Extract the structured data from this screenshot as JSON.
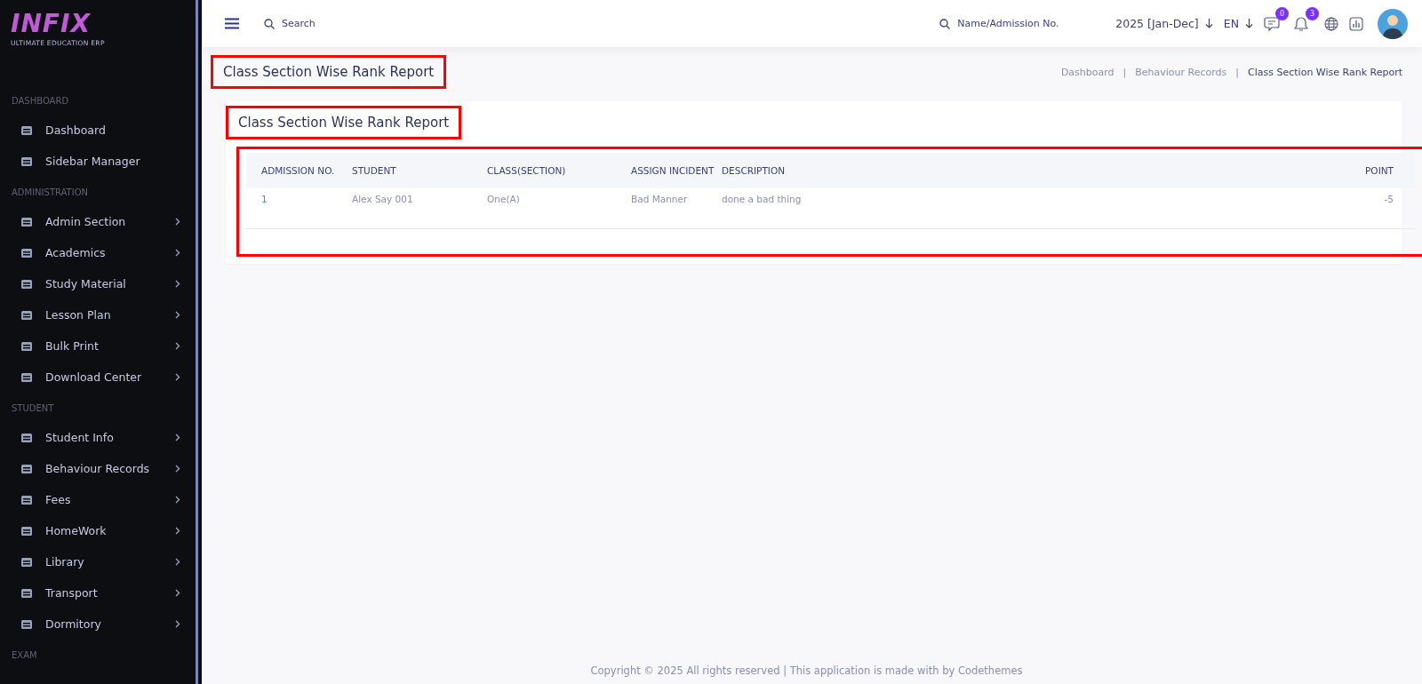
{
  "logo": {
    "title": "INFIX",
    "tagline": "ULTIMATE EDUCATION ERP"
  },
  "sidebar": {
    "sections": [
      {
        "label": "DASHBOARD",
        "items": [
          {
            "label": "Dashboard",
            "has_submenu": false
          },
          {
            "label": "Sidebar Manager",
            "has_submenu": false
          }
        ]
      },
      {
        "label": "ADMINISTRATION",
        "items": [
          {
            "label": "Admin Section",
            "has_submenu": true
          },
          {
            "label": "Academics",
            "has_submenu": true
          },
          {
            "label": "Study Material",
            "has_submenu": true
          },
          {
            "label": "Lesson Plan",
            "has_submenu": true
          },
          {
            "label": "Bulk Print",
            "has_submenu": true
          },
          {
            "label": "Download Center",
            "has_submenu": true
          }
        ]
      },
      {
        "label": "STUDENT",
        "items": [
          {
            "label": "Student Info",
            "has_submenu": true
          },
          {
            "label": "Behaviour Records",
            "has_submenu": true
          },
          {
            "label": "Fees",
            "has_submenu": true
          },
          {
            "label": "HomeWork",
            "has_submenu": true
          },
          {
            "label": "Library",
            "has_submenu": true
          },
          {
            "label": "Transport",
            "has_submenu": true
          },
          {
            "label": "Dormitory",
            "has_submenu": true
          }
        ]
      },
      {
        "label": "EXAM"
      }
    ]
  },
  "topbar": {
    "search": {
      "placeholder": "Search"
    },
    "student_search": {
      "placeholder": "Name/Admission No."
    },
    "session": "2025 [Jan-Dec]",
    "language": "EN",
    "message_count": "0",
    "notification_count": "3"
  },
  "page": {
    "title": "Class Section Wise Rank Report",
    "highlighted": true,
    "breadcrumb": [
      {
        "kind": "link",
        "label": "Dashboard",
        "selected": false
      },
      {
        "kind": "separator",
        "label": "|"
      },
      {
        "kind": "link",
        "label": "Behaviour Records",
        "selected": false
      },
      {
        "kind": "separator",
        "label": "|"
      },
      {
        "kind": "link",
        "label": "Class Section Wise Rank Report",
        "selected": true
      }
    ]
  },
  "card": {
    "title": "Class Section Wise Rank Report",
    "highlighted": true
  },
  "table": {
    "highlighted": true,
    "columns": [
      "ADMISSION NO.",
      "STUDENT",
      "CLASS(SECTION)",
      "ASSIGN INCIDENT",
      "DESCRIPTION",
      "POINT"
    ],
    "rows": [
      [
        "1",
        "Alex Say 001",
        "One(A)",
        "Bad Manner",
        "done a bad thing",
        "-5"
      ]
    ]
  },
  "footer": "Copyright © 2025 All rights reserved | This application is made with by Codethemes"
}
